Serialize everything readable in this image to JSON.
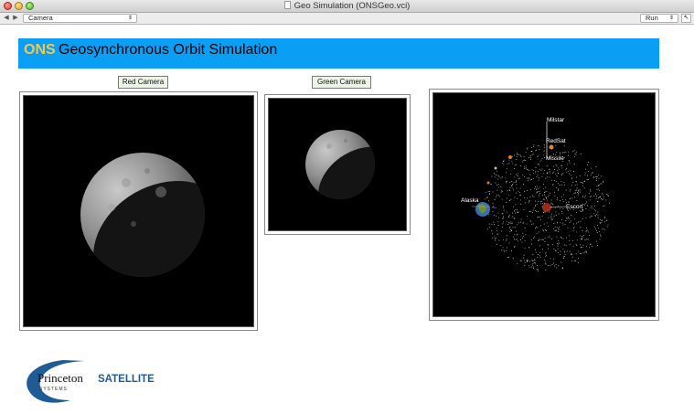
{
  "window": {
    "title": "Geo Simulation (ONSGeo.vci)"
  },
  "toolbar": {
    "back_glyph": "◀",
    "forward_glyph": "▶",
    "camera_select": "Camera",
    "run_select": "Run",
    "select_arrow": "⇕",
    "cursor_glyph": "↖"
  },
  "banner": {
    "brand": "ONS",
    "title": "Geosynchronous Orbit Simulation",
    "color": "#0a9ef5"
  },
  "red_camera": {
    "label": "Red Camera"
  },
  "green_camera": {
    "label": "Green Camera"
  },
  "orbit_view": {
    "labels": {
      "milstar": "Milstar",
      "redsat": "RedSat",
      "missile": "Missile",
      "alaska": "Alaska",
      "escort": "Escort"
    }
  },
  "logo": {
    "name": "Princeton",
    "name_bold": "SATELLITE",
    "sub": "SYSTEMS"
  }
}
